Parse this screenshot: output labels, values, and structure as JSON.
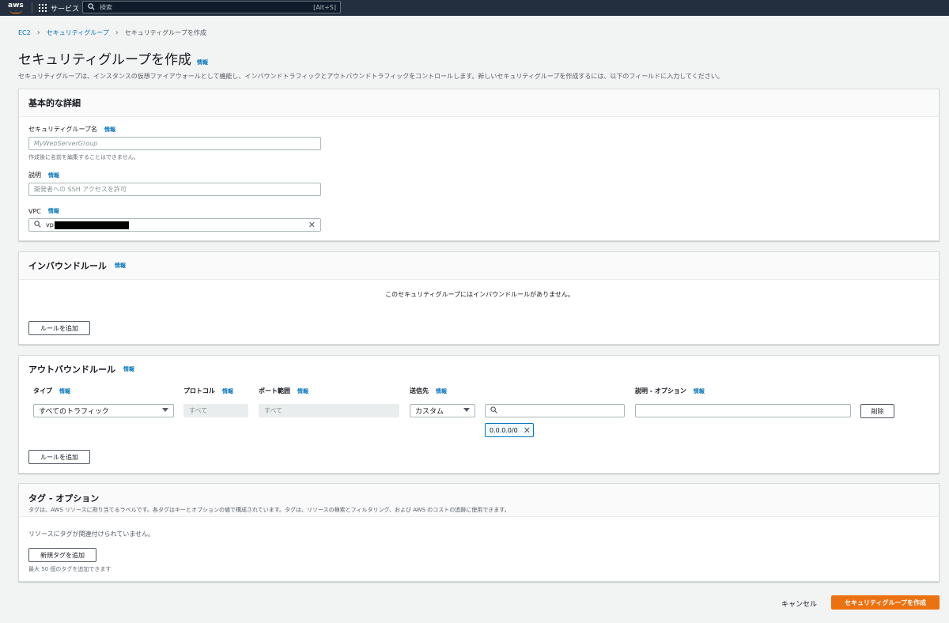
{
  "topnav": {
    "logo_text": "aws",
    "services_label": "サービス",
    "search_placeholder": "検索",
    "search_shortcut": "[Alt+S]"
  },
  "breadcrumb": {
    "items": [
      "EC2",
      "セキュリティグループ",
      "セキュリティグループを作成"
    ]
  },
  "page": {
    "title": "セキュリティグループを作成",
    "info": "情報",
    "description": "セキュリティグループは、インスタンスの仮想ファイアウォールとして機能し、インバウンドトラフィックとアウトバウンドトラフィックをコントロールします。新しいセキュリティグループを作成するには、以下のフィールドに入力してください。"
  },
  "basic": {
    "title": "基本的な詳細",
    "name_label": "セキュリティグループ名",
    "name_placeholder": "MyWebServerGroup",
    "name_hint": "作成後に名前を編集することはできません。",
    "desc_label": "説明",
    "desc_placeholder": "開発者への SSH アクセスを許可",
    "vpc_label": "VPC",
    "vpc_value_prefix": "vp",
    "info": "情報"
  },
  "inbound": {
    "title": "インバウンドルール",
    "info": "情報",
    "empty_text": "このセキュリティグループにはインバウンドルールがありません。",
    "add_rule": "ルールを追加"
  },
  "outbound": {
    "title": "アウトバウンドルール",
    "info": "情報",
    "columns": [
      "タイプ",
      "プロトコル",
      "ポート範囲",
      "送信先",
      "説明 - オプション"
    ],
    "row": {
      "type": "すべてのトラフィック",
      "protocol": "すべて",
      "port_range": "すべて",
      "destination": "カスタム",
      "cidr_token": "0.0.0.0/0",
      "delete": "削除"
    },
    "add_rule": "ルールを追加"
  },
  "tags": {
    "title": "タグ - オプション",
    "description": "タグは、AWS リソースに割り当てるラベルです。各タグはキーとオプションの値で構成されています。タグは、リソースの検索とフィルタリング、および AWS のコストの追跡に使用できます。",
    "empty_text": "リソースにタグが関連付けられていません。",
    "add_tag": "新規タグを追加",
    "limit_hint": "最大 50 個のタグを追加できます"
  },
  "footer": {
    "cancel": "キャンセル",
    "create": "セキュリティグループを作成"
  },
  "colors": {
    "nav_bg": "#232f3e",
    "link": "#0073bb",
    "primary": "#ec7211"
  }
}
